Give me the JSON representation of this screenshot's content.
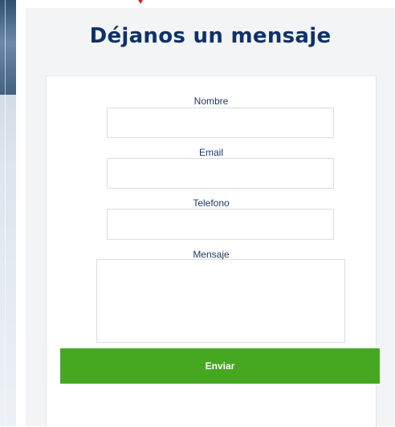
{
  "form": {
    "title": "Déjanos un mensaje",
    "fields": {
      "name": {
        "label": "Nombre",
        "value": ""
      },
      "email": {
        "label": "Email",
        "value": ""
      },
      "phone": {
        "label": "Telefono",
        "value": ""
      },
      "message": {
        "label": "Mensaje",
        "value": ""
      }
    },
    "submit_label": "Enviar"
  },
  "colors": {
    "title": "#0f3168",
    "label": "#1f3a66",
    "button": "#46a820",
    "panel": "#f3f4f6",
    "marker": "#d2232a"
  },
  "icons": {
    "marker": "red-arrow-down-icon"
  }
}
